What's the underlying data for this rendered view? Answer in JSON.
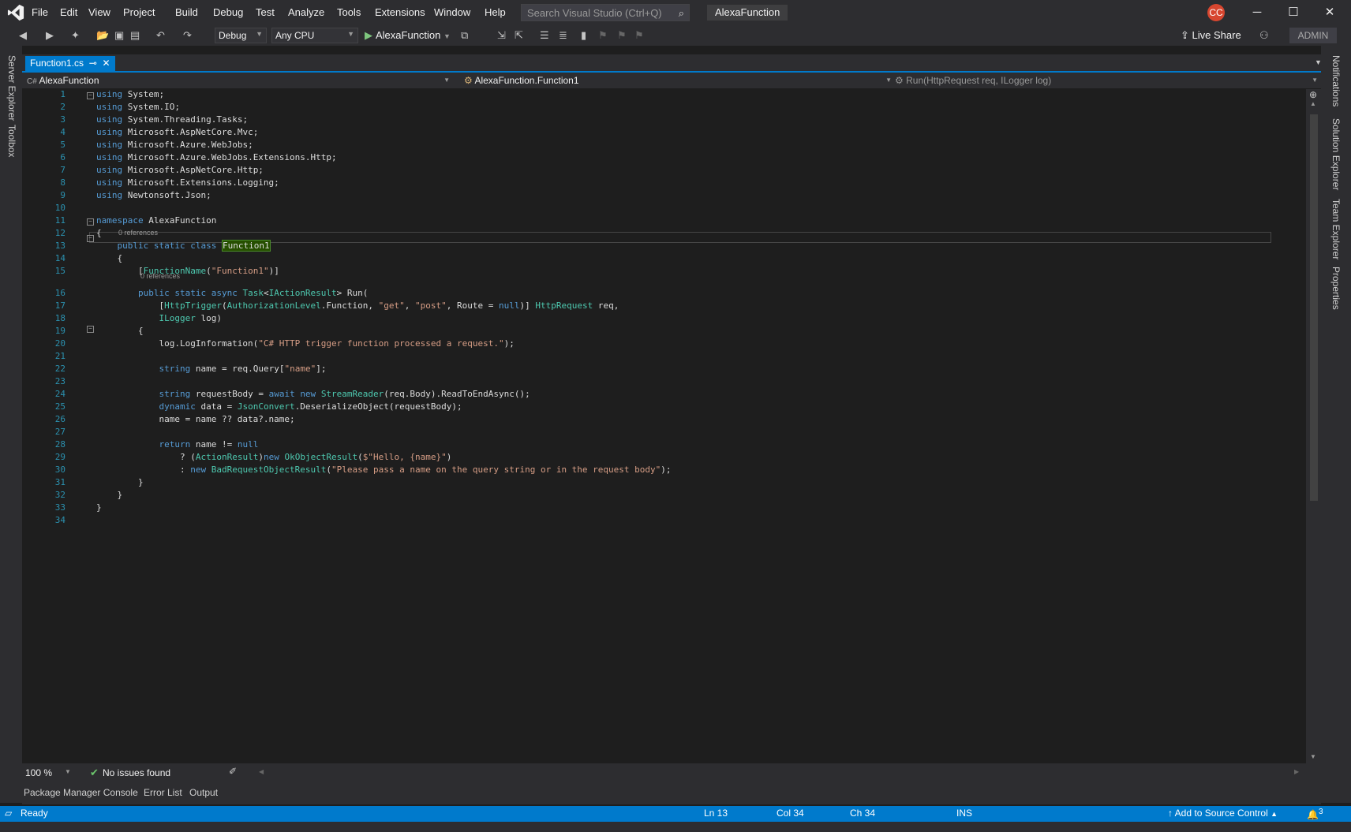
{
  "menu": [
    "File",
    "Edit",
    "View",
    "Project",
    "Build",
    "Debug",
    "Test",
    "Analyze",
    "Tools",
    "Extensions",
    "Window",
    "Help"
  ],
  "search": {
    "placeholder": "Search Visual Studio (Ctrl+Q)"
  },
  "solution_name": "AlexaFunction",
  "user_initials": "CC",
  "toolbar": {
    "config": "Debug",
    "platform": "Any CPU",
    "startup": "AlexaFunction",
    "live_share": "Live Share",
    "admin": "ADMIN"
  },
  "left_tabs": [
    "Server Explorer",
    "Toolbox"
  ],
  "right_tabs": [
    "Notifications",
    "Solution Explorer",
    "Team Explorer",
    "Properties"
  ],
  "doc_tab": {
    "name": "Function1.cs",
    "pin": "⊸",
    "close": "✕"
  },
  "nav": {
    "project": "AlexaFunction",
    "type": "AlexaFunction.Function1",
    "member": "Run(HttpRequest req, ILogger log)"
  },
  "code_lens": [
    "0 references",
    "0 references"
  ],
  "line_numbers": [
    "1",
    "2",
    "3",
    "4",
    "5",
    "6",
    "7",
    "8",
    "9",
    "10",
    "11",
    "12",
    "13",
    "14",
    "15",
    "16",
    "17",
    "18",
    "19",
    "20",
    "21",
    "22",
    "23",
    "24",
    "25",
    "26",
    "27",
    "28",
    "29",
    "30",
    "31",
    "32",
    "33",
    "34"
  ],
  "info": {
    "zoom": "100 %",
    "issues": "No issues found"
  },
  "bottom_tabs": [
    "Package Manager Console",
    "Error List",
    "Output"
  ],
  "status": {
    "ready": "Ready",
    "ln": "Ln 13",
    "col": "Col 34",
    "ch": "Ch 34",
    "ins": "INS",
    "source_control": "Add to Source Control",
    "notif_count": "3"
  },
  "colors": {
    "accent": "#007acc",
    "chrome": "#2d2d30",
    "editor_bg": "#1e1e1e",
    "keyword": "#569cd6",
    "type": "#4ec9b0",
    "string": "#d69d85"
  }
}
